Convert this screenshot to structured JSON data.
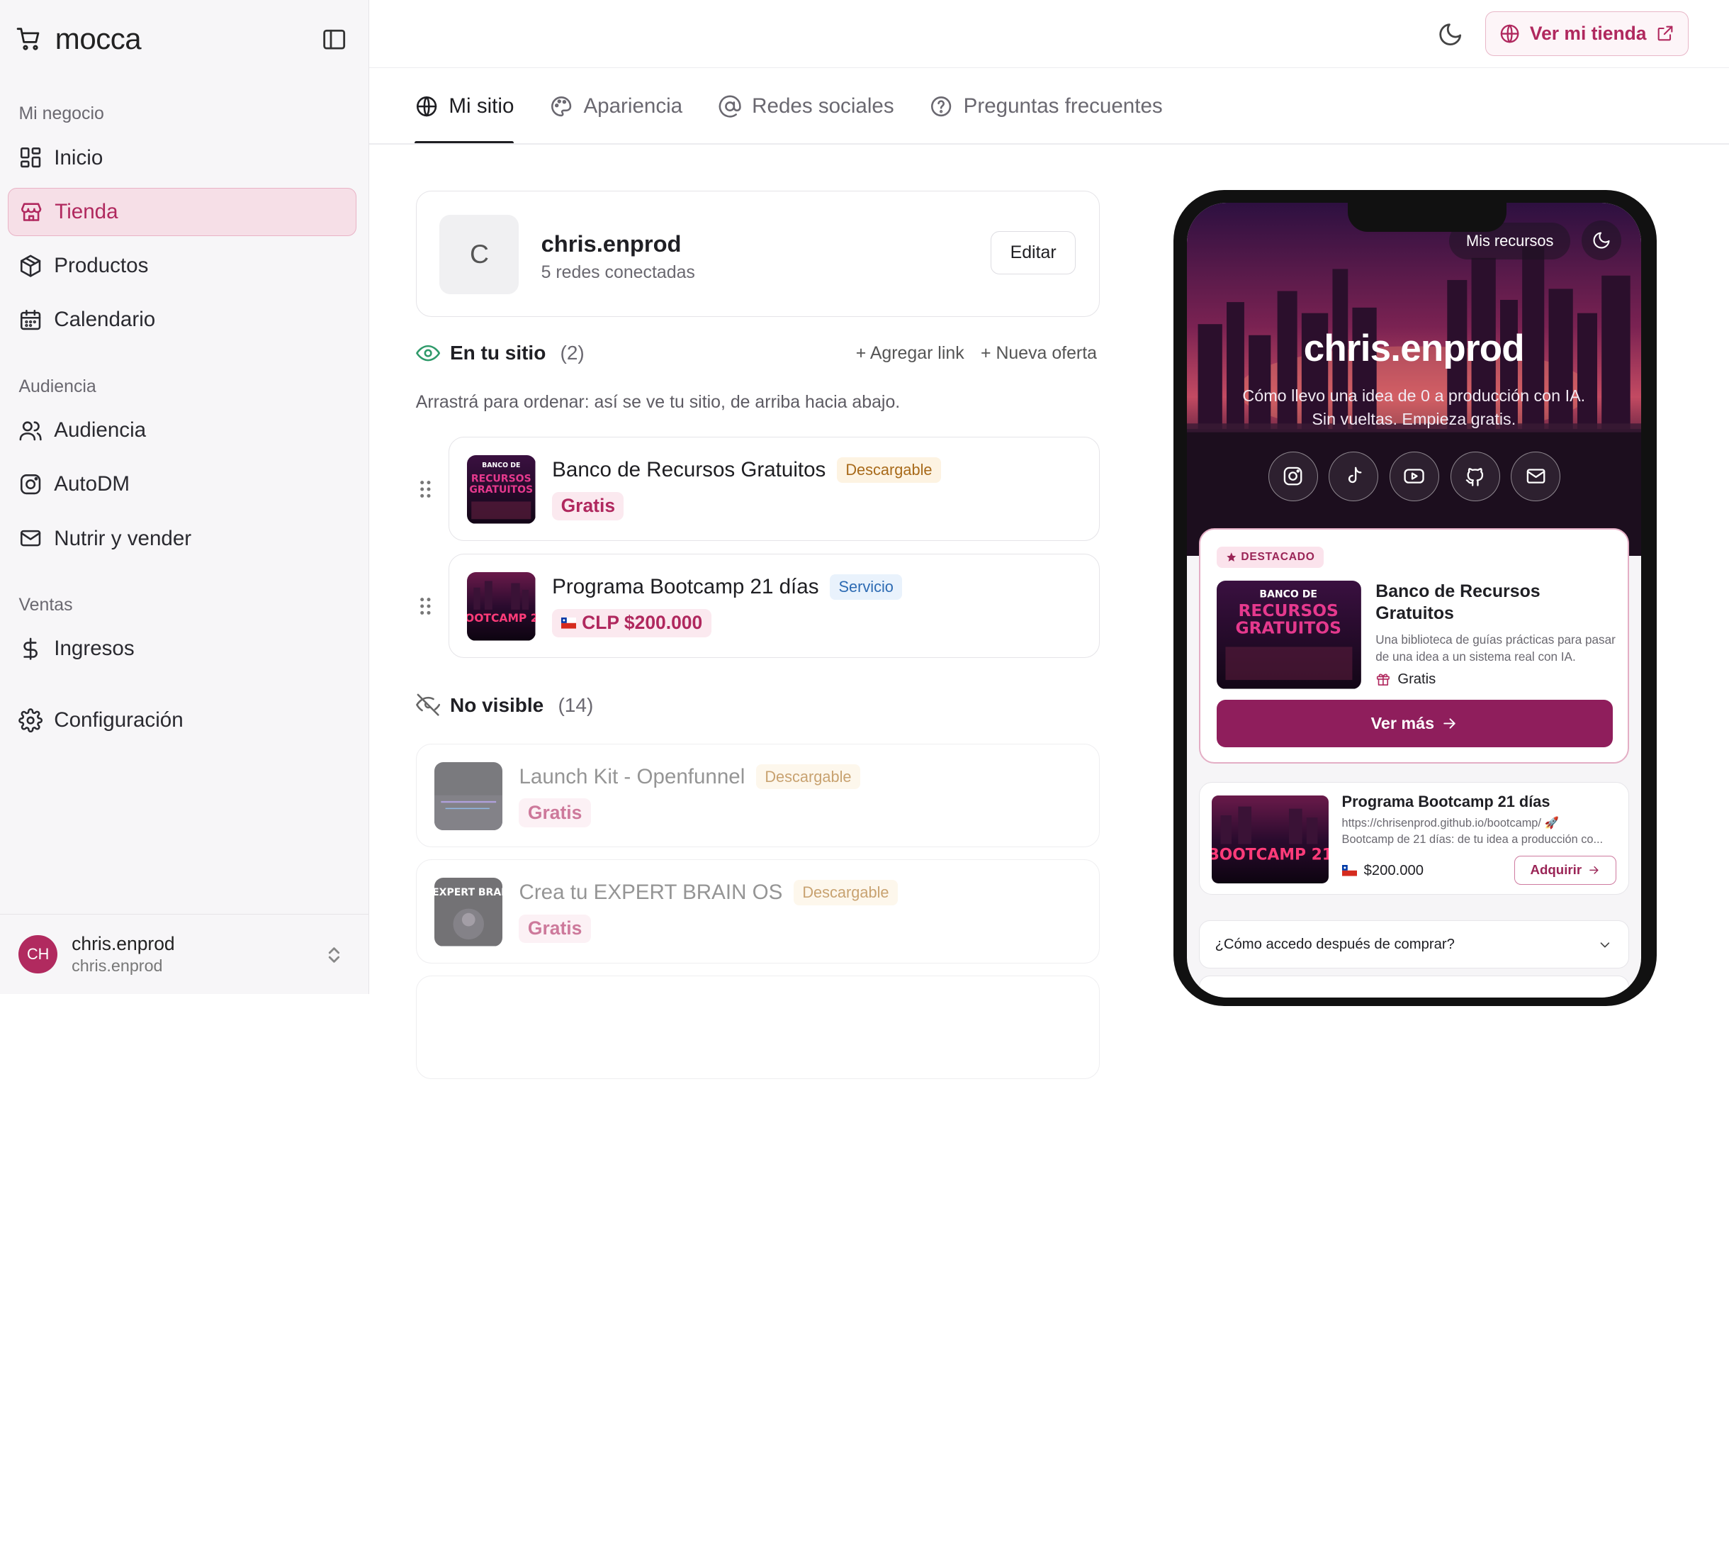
{
  "brand": {
    "name": "mocca"
  },
  "sidebar": {
    "sections": [
      {
        "label": "Mi negocio"
      },
      {
        "label": "Audiencia"
      },
      {
        "label": "Ventas"
      }
    ],
    "items": [
      {
        "label": "Inicio"
      },
      {
        "label": "Tienda"
      },
      {
        "label": "Productos"
      },
      {
        "label": "Calendario"
      },
      {
        "label": "Audiencia"
      },
      {
        "label": "AutoDM"
      },
      {
        "label": "Nutrir y vender"
      },
      {
        "label": "Ingresos"
      },
      {
        "label": "Configuración"
      }
    ],
    "user": {
      "initials": "CH",
      "name": "chris.enprod",
      "handle": "chris.enprod"
    }
  },
  "topbar": {
    "store_button": "Ver mi tienda"
  },
  "tabs": [
    {
      "label": "Mi sitio"
    },
    {
      "label": "Apariencia"
    },
    {
      "label": "Redes sociales"
    },
    {
      "label": "Preguntas frecuentes"
    }
  ],
  "profile": {
    "initial": "C",
    "name": "chris.enprod",
    "subtitle": "5 redes conectadas",
    "edit_label": "Editar"
  },
  "on_site": {
    "title": "En tu sitio",
    "count": "(2)",
    "add_link": "+ Agregar link",
    "new_offer": "+ Nueva oferta",
    "hint": "Arrastrá para ordenar: así se ve tu sitio, de arriba hacia abajo.",
    "items": [
      {
        "title": "Banco de Recursos Gratuitos",
        "type": "Descargable",
        "price": "Gratis"
      },
      {
        "title": "Programa Bootcamp 21 días",
        "type": "Servicio",
        "price": "CLP $200.000"
      }
    ]
  },
  "not_visible": {
    "title": "No visible",
    "count": "(14)",
    "items": [
      {
        "title": "Launch Kit - Openfunnel",
        "type": "Descargable",
        "price": "Gratis"
      },
      {
        "title": "Crea tu EXPERT BRAIN OS",
        "type": "Descargable",
        "price": "Gratis"
      }
    ]
  },
  "preview": {
    "mis_recursos": "Mis recursos",
    "name": "chris.enprod",
    "bio_line1": "Cómo llevo una idea de 0 a producción con IA.",
    "bio_line2": "Sin vueltas. Empieza gratis.",
    "featured": {
      "badge": "DESTACADO",
      "title": "Banco de Recursos Gratuitos",
      "desc": "Una biblioteca de guías prácticas para pasar de una idea a un sistema real con IA.",
      "price": "Gratis",
      "cta": "Ver más"
    },
    "program": {
      "title": "Programa Bootcamp 21 días",
      "url": "https://chrisenprod.github.io/bootcamp/ 🚀",
      "desc": "Bootcamp de 21 días: de tu idea a producción co...",
      "price": "$200.000",
      "cta": "Adquirir"
    },
    "faq_question": "¿Cómo accedo después de comprar?"
  },
  "thumb_text": {
    "banco_top": "BANCO DE",
    "banco_main1": "RECURSOS",
    "banco_main2": "GRATUITOS",
    "bootcamp": "BOOTCAMP 21",
    "expert": "EXPERT BRAI"
  },
  "colors": {
    "accent": "#b0285e",
    "accent_dark": "#8f1e5c",
    "sidebar_bg": "#f7f6f8"
  }
}
